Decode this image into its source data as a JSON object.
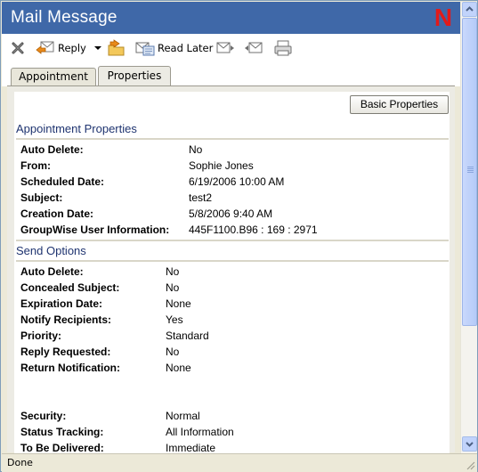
{
  "window": {
    "title": "Mail Message",
    "logo_letter": "N"
  },
  "toolbar": {
    "close_icon": "close-x-icon",
    "reply_label": "Reply",
    "read_later_label": "Read Later"
  },
  "tabs": [
    {
      "label": "Appointment",
      "active": false
    },
    {
      "label": "Properties",
      "active": true
    }
  ],
  "basic_properties_label": "Basic Properties",
  "appointment_properties": {
    "heading": "Appointment  Properties",
    "rows": [
      {
        "label": "Auto Delete:",
        "value": "No"
      },
      {
        "label": "From:",
        "value": "Sophie Jones"
      },
      {
        "label": "Scheduled Date:",
        "value": "6/19/2006 10:00 AM"
      },
      {
        "label": "Subject:",
        "value": "test2"
      },
      {
        "label": "Creation Date:",
        "value": "5/8/2006 9:40 AM"
      },
      {
        "label": "GroupWise User Information:",
        "value": "445F1100.B96 : 169 : 2971"
      }
    ]
  },
  "send_options": {
    "heading": "Send Options",
    "rows": [
      {
        "label": "Auto Delete:",
        "value": "No"
      },
      {
        "label": "Concealed Subject:",
        "value": "No"
      },
      {
        "label": "Expiration Date:",
        "value": "None"
      },
      {
        "label": "Notify Recipients:",
        "value": "Yes"
      },
      {
        "label": "Priority:",
        "value": "Standard"
      },
      {
        "label": "Reply Requested:",
        "value": "No"
      },
      {
        "label": "Return Notification:",
        "value": "None"
      },
      {
        "label": "Security:",
        "value": "Normal"
      },
      {
        "label": "Status Tracking:",
        "value": "All Information"
      },
      {
        "label": "To Be Delivered:",
        "value": "Immediate"
      }
    ]
  },
  "status": {
    "text": "Done"
  },
  "colors": {
    "titlebar": "#3f68a8",
    "section_heading": "#1f3470",
    "logo": "#e21a1a"
  }
}
